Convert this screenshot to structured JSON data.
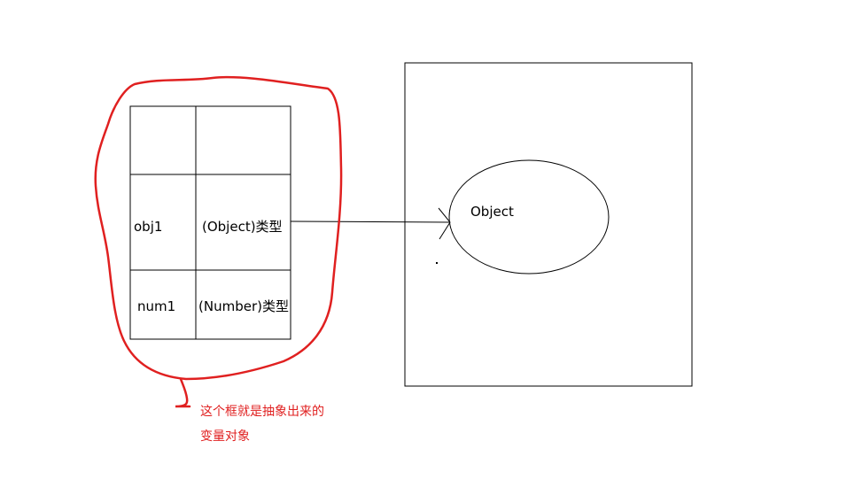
{
  "variable_object": {
    "rows": [
      {
        "name": "",
        "type": ""
      },
      {
        "name": "obj1",
        "type": "(Object)类型"
      },
      {
        "name": "num1",
        "type": "(Number)类型"
      }
    ]
  },
  "heap": {
    "object_label": "Object"
  },
  "annotation": {
    "line1": "这个框就是抽象出来的",
    "line2": "变量对象",
    "color": "#e02020"
  },
  "colors": {
    "stroke": "#000000",
    "highlight": "#e02020"
  }
}
